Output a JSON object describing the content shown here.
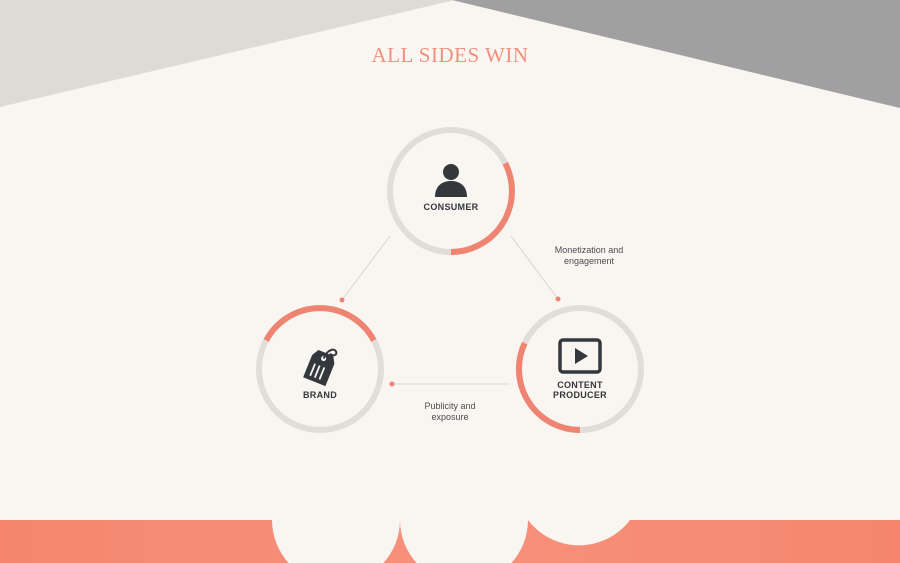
{
  "title": "ALL SIDES WIN",
  "colors": {
    "background": "#f9f6f1",
    "accent": "#f08473",
    "ring_track": "#e1ddd8",
    "icon_dark": "#34373c",
    "wedge_left": "#dedbd7",
    "wedge_right": "#a0a0a0",
    "footer": "#f5866d"
  },
  "nodes": {
    "consumer": {
      "label": "CONSUMER",
      "icon": "person-icon"
    },
    "brand": {
      "label": "BRAND",
      "icon": "price-tag-icon"
    },
    "producer": {
      "label_line1": "CONTENT",
      "label_line2": "PRODUCER",
      "icon": "video-play-icon"
    }
  },
  "edges": {
    "consumer_producer": {
      "line1": "Monetization and",
      "line2": "engagement"
    },
    "producer_brand": {
      "line1": "Publicity and",
      "line2": "exposure"
    }
  }
}
